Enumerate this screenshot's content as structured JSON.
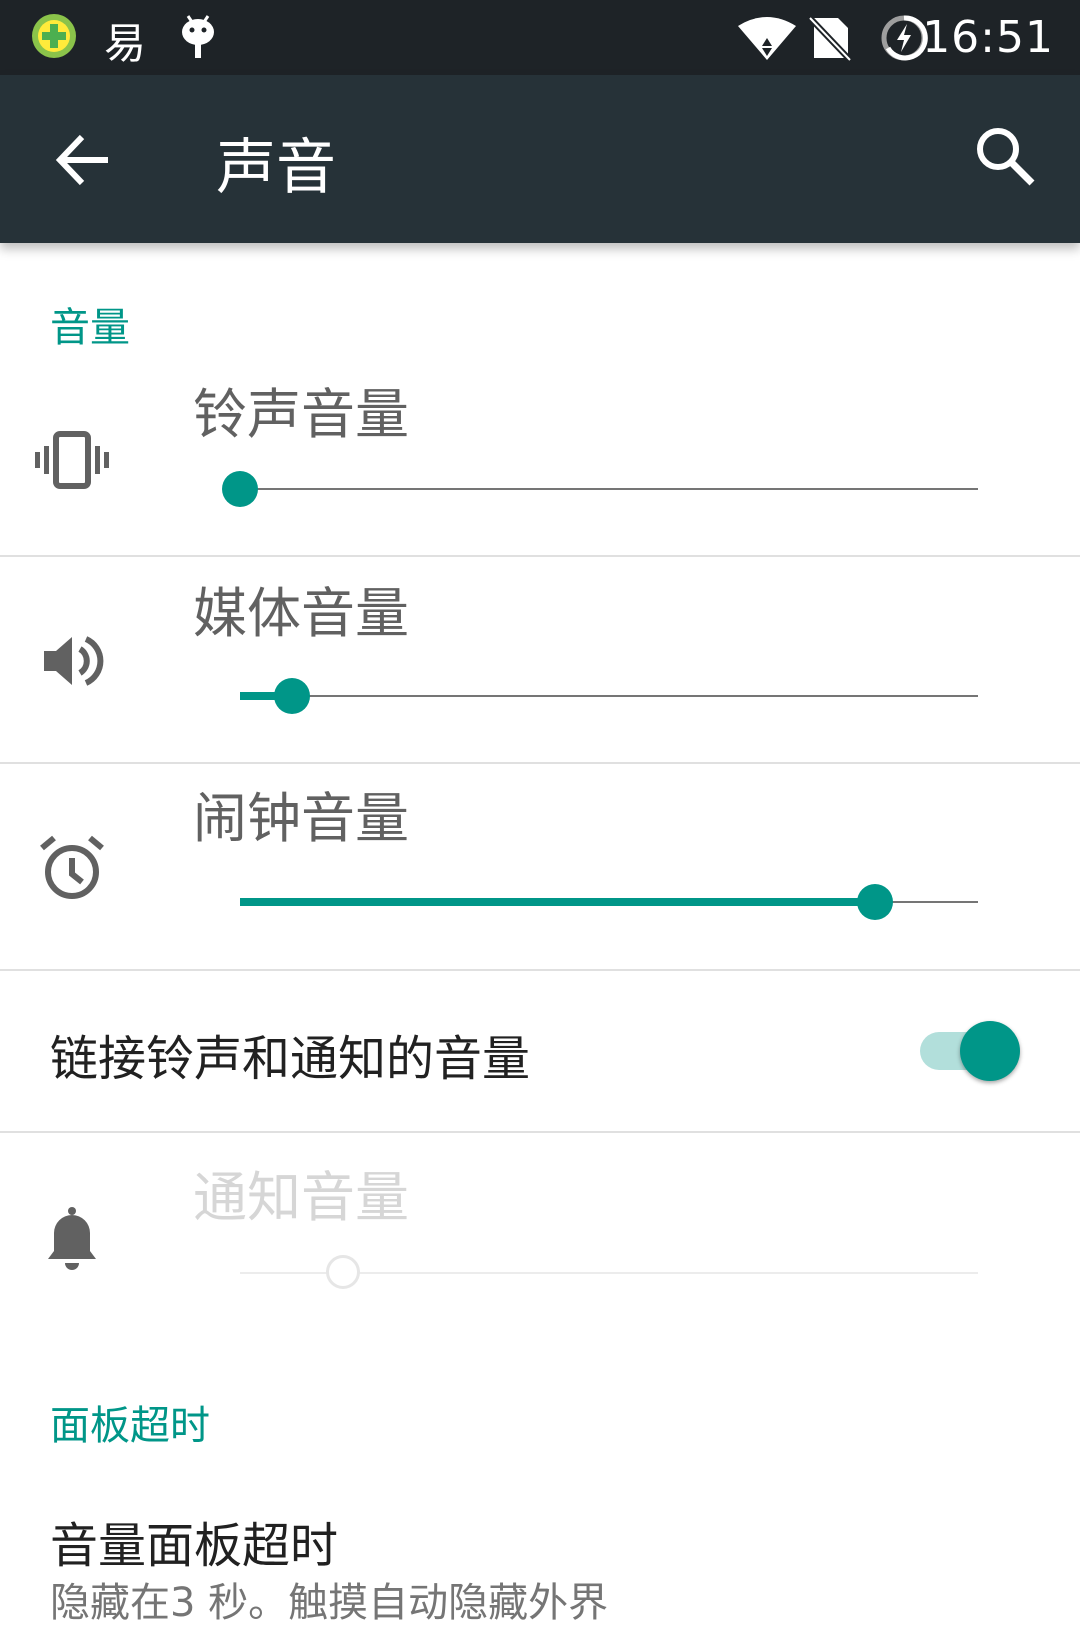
{
  "status_bar": {
    "time": "16:51",
    "notification_icons": [
      "plus-circle-app-icon",
      "yi-app-icon",
      "android-icon"
    ],
    "system_icons": [
      "wifi-icon",
      "no-sim-icon",
      "battery-charging-icon"
    ],
    "yi_glyph": "易"
  },
  "app_bar": {
    "title": "声音",
    "back_icon": "arrow-back-icon",
    "search_icon": "search-icon"
  },
  "volume_section": {
    "header": "音量",
    "rows": [
      {
        "label": "铃声音量",
        "icon": "vibrate-icon",
        "level": 0.0
      },
      {
        "label": "媒体音量",
        "icon": "speaker-icon",
        "level": 0.07
      },
      {
        "label": "闹钟音量",
        "icon": "alarm-clock-icon",
        "level": 0.86
      }
    ],
    "link_toggle": {
      "label": "链接铃声和通知的音量",
      "on": true
    },
    "notification": {
      "label": "通知音量",
      "icon": "bell-icon",
      "level": 0.14,
      "disabled": true
    }
  },
  "panel_section": {
    "header": "面板超时",
    "item_title": "音量面板超时",
    "item_summary": "隐藏在3 秒。触摸自动隐藏外界"
  },
  "colors": {
    "accent": "#009688",
    "accent_light": "#b2dfdb",
    "app_bar": "#263238",
    "status_bar": "#1e2327"
  }
}
